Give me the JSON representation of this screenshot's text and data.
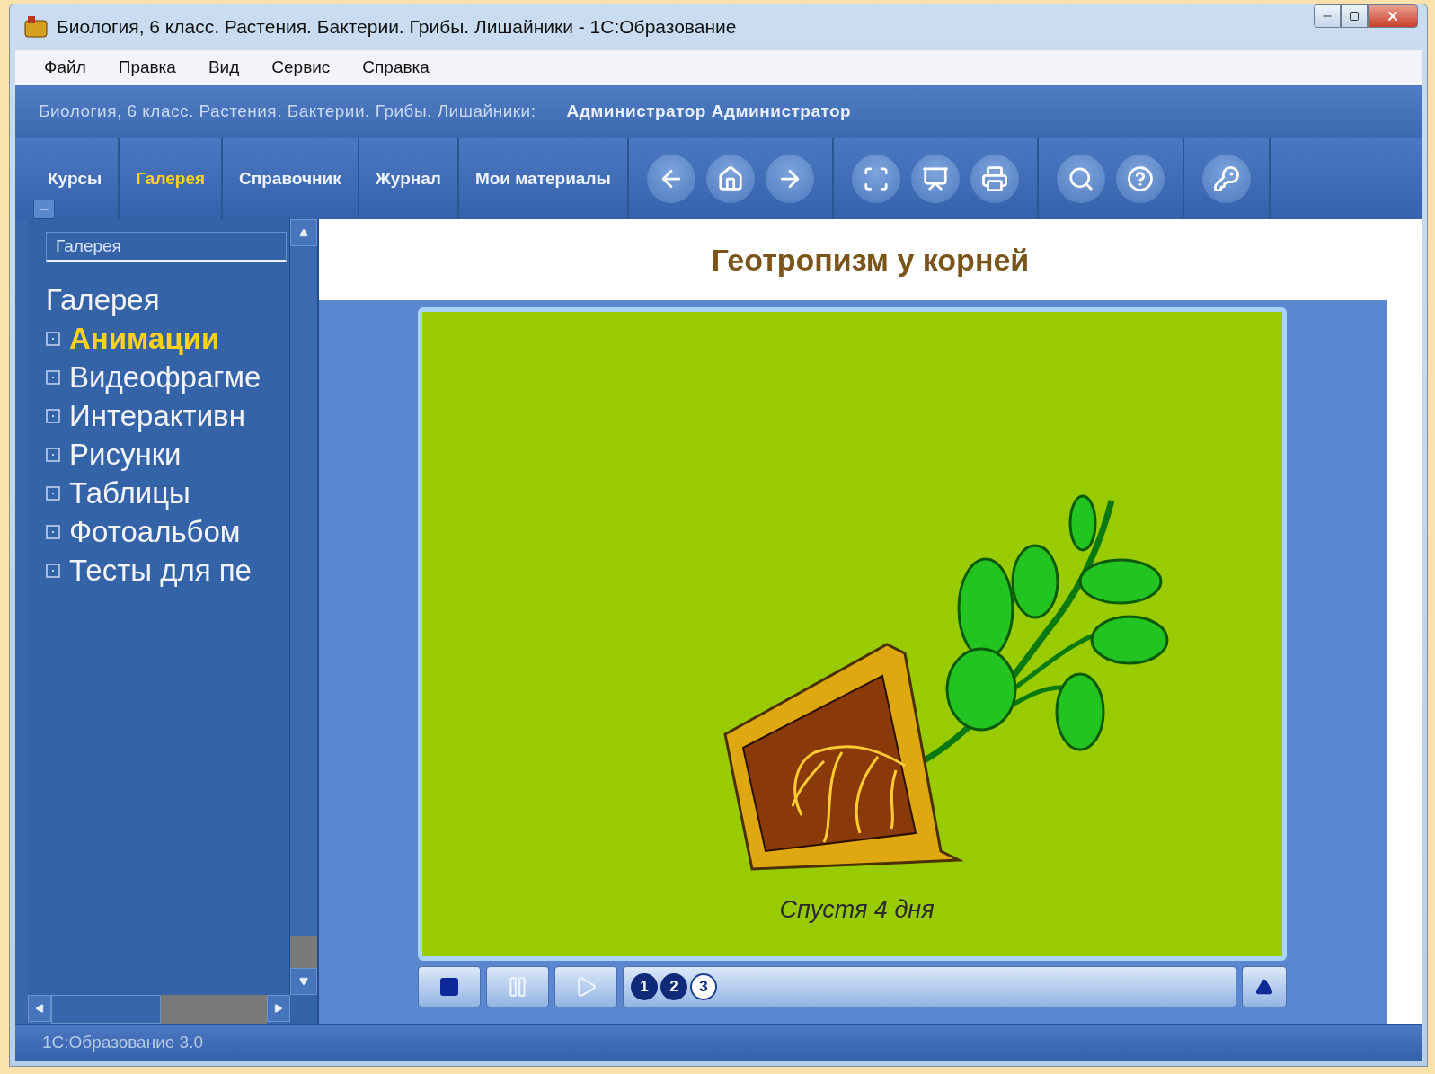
{
  "window": {
    "title": "Биология, 6 класс. Растения. Бактерии. Грибы. Лишайники - 1С:Образование"
  },
  "menu": [
    "Файл",
    "Правка",
    "Вид",
    "Сервис",
    "Справка"
  ],
  "header": {
    "course": "Биология, 6 класс. Растения. Бактерии. Грибы. Лишайники:",
    "user": "Администратор Администратор"
  },
  "tabs": [
    {
      "label": "Курсы",
      "selected": false
    },
    {
      "label": "Галерея",
      "selected": true
    },
    {
      "label": "Справочник",
      "selected": false
    },
    {
      "label": "Журнал",
      "selected": false
    },
    {
      "label": "Мои материалы",
      "selected": false
    }
  ],
  "sidebar": {
    "search": {
      "value": "Галерея"
    },
    "root": "Галерея",
    "items": [
      {
        "label": "Анимации",
        "selected": true
      },
      {
        "label": "Видеофрагме",
        "selected": false
      },
      {
        "label": "Интерактивн",
        "selected": false
      },
      {
        "label": "Рисунки",
        "selected": false
      },
      {
        "label": "Таблицы",
        "selected": false
      },
      {
        "label": "Фотоальбом",
        "selected": false
      },
      {
        "label": "Тесты для пе",
        "selected": false
      }
    ]
  },
  "content": {
    "title": "Геотропизм у корней",
    "caption": "Спустя 4 дня",
    "frames": [
      {
        "label": "1",
        "selected": false
      },
      {
        "label": "2",
        "selected": false
      },
      {
        "label": "3",
        "selected": true
      }
    ]
  },
  "status_bar": "1С:Образование 3.0"
}
